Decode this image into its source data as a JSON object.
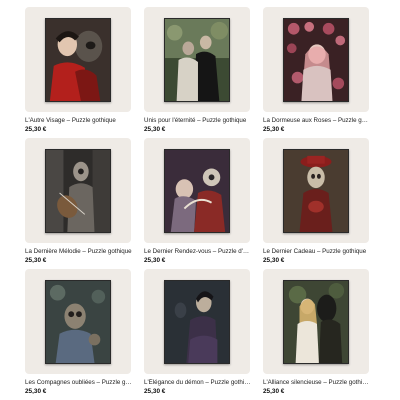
{
  "products": [
    {
      "title": "L'Autre Visage – Puzzle gothique",
      "price": "25,30 €",
      "art": "red-dress-woman-with-skull-art"
    },
    {
      "title": "Unis pour l'éternité – Puzzle gothique",
      "price": "25,30 €",
      "art": "couple-in-garden-art"
    },
    {
      "title": "La Dormeuse aux Roses – Puzzle gothique",
      "price": "25,30 €",
      "art": "sleeping-woman-roses-art"
    },
    {
      "title": "La Dernière Mélodie – Puzzle gothique",
      "price": "25,30 €",
      "art": "skeleton-violinist-art"
    },
    {
      "title": "Le Dernier Rendez-vous – Puzzle d'horreur gothique",
      "price": "25,30 €",
      "art": "dance-couple-art"
    },
    {
      "title": "Le Dernier Cadeau – Puzzle gothique",
      "price": "25,30 €",
      "art": "skull-woman-red-hat-art"
    },
    {
      "title": "Les Compagnes oubliées – Puzzle gothique",
      "price": "25,30 €",
      "art": "forgotten-companions-art"
    },
    {
      "title": "L'Élégance du démon – Puzzle gothique",
      "price": "25,30 €",
      "art": "demon-elegance-art"
    },
    {
      "title": "L'Alliance silencieuse – Puzzle gothique",
      "price": "25,30 €",
      "art": "silent-alliance-art"
    }
  ]
}
